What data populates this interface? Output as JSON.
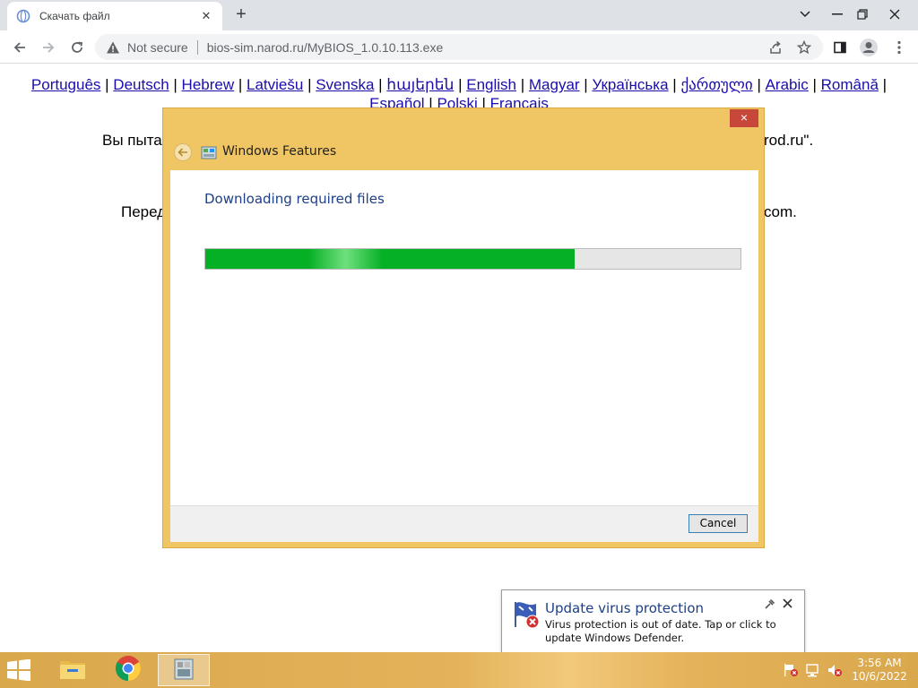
{
  "browser": {
    "tab_title": "Скачать файл",
    "new_tab_symbol": "+",
    "address": {
      "security_label": "Not secure",
      "url": "bios-sim.narod.ru/MyBIOS_1.0.10.113.exe"
    }
  },
  "page": {
    "languages": [
      "Português",
      "Deutsch",
      "Hebrew",
      "Latviešu",
      "Svenska",
      "հայերեն",
      "English",
      "Magyar",
      "Українська",
      "ქართული",
      "Arabic",
      "Română",
      "Español",
      "Polski",
      "Français"
    ],
    "separator": " | ",
    "line1_start": "Вы пыта",
    "line1_end": "rod.ru\".",
    "line2_start": "Перед",
    "line2_end": "com."
  },
  "dialog": {
    "title": "Windows Features",
    "heading": "Downloading required files",
    "progress_fraction": 0.69,
    "cancel_label": "Cancel",
    "close_symbol": "×"
  },
  "toast": {
    "title": "Update virus protection",
    "message": "Virus protection is out of date. Tap or click to update Windows Defender."
  },
  "taskbar": {
    "time": "3:56 AM",
    "date": "10/6/2022"
  },
  "colors": {
    "accent_yellow": "#f0c664",
    "progress_green": "#06b025",
    "link": "#1a0dab",
    "close_red": "#c7483a",
    "toast_title": "#1e3f87"
  }
}
